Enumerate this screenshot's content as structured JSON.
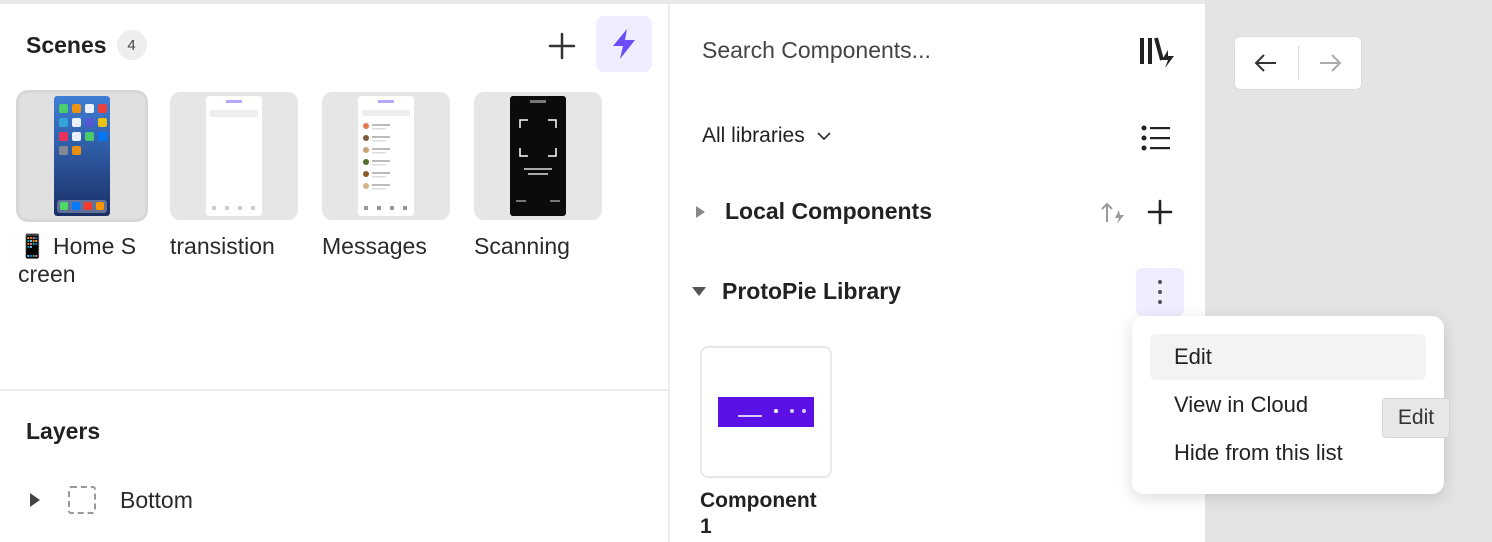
{
  "scenes": {
    "title": "Scenes",
    "count": "4",
    "items": [
      {
        "label": "📱 Home Screen",
        "selected": true
      },
      {
        "label": "transistion",
        "selected": false
      },
      {
        "label": "Messages",
        "selected": false
      },
      {
        "label": "Scanning",
        "selected": false
      }
    ]
  },
  "layers": {
    "title": "Layers",
    "items": [
      {
        "label": "Bottom"
      }
    ]
  },
  "components": {
    "search_placeholder": "Search Components...",
    "filter_label": "All libraries",
    "sections": [
      {
        "label": "Local Components",
        "expanded": false
      },
      {
        "label": "ProtoPie Library",
        "expanded": true
      }
    ],
    "items": [
      {
        "label": "Component 1"
      }
    ]
  },
  "context_menu": {
    "items": [
      "Edit",
      "View in Cloud",
      "Hide from this list"
    ],
    "tooltip": "Edit"
  },
  "colors": {
    "accent": "#6b4ef6",
    "accent_bg": "#efedff",
    "component_fill": "#5b10e6",
    "canvas": "#e4e4e4"
  }
}
